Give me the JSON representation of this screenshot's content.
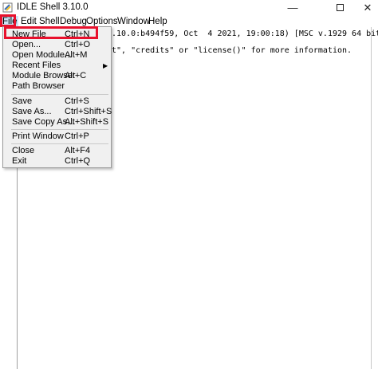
{
  "window": {
    "title": "IDLE Shell 3.10.0",
    "minimize_glyph": "—",
    "close_glyph": "✕"
  },
  "menubar": {
    "items": [
      "File",
      "Edit",
      "Shell",
      "Debug",
      "Options",
      "Window",
      "Help"
    ]
  },
  "shell": {
    "line1": "3.10.0:b494f59, Oct  4 2021, 19:00:18) [MSC v.1929 64 bit (",
    "line2": "ht\", \"credits\" or \"license()\" for more information."
  },
  "file_menu": {
    "items": [
      {
        "label": "New File",
        "shortcut": "Ctrl+N"
      },
      {
        "label": "Open...",
        "shortcut": "Ctrl+O"
      },
      {
        "label": "Open Module...",
        "shortcut": "Alt+M"
      },
      {
        "label": "Recent Files",
        "shortcut": "",
        "submenu_arrow": "▶"
      },
      {
        "label": "Module Browser",
        "shortcut": "Alt+C"
      },
      {
        "label": "Path Browser",
        "shortcut": ""
      },
      {
        "label": "Save",
        "shortcut": "Ctrl+S"
      },
      {
        "label": "Save As...",
        "shortcut": "Ctrl+Shift+S"
      },
      {
        "label": "Save Copy As...",
        "shortcut": "Alt+Shift+S"
      },
      {
        "label": "Print Window",
        "shortcut": "Ctrl+P"
      },
      {
        "label": "Close",
        "shortcut": "Alt+F4"
      },
      {
        "label": "Exit",
        "shortcut": "Ctrl+Q"
      }
    ]
  },
  "colors": {
    "highlight_border": "#e8112d",
    "menu_hover": "#cce4f7",
    "menu_background": "#f0f0f0"
  },
  "icons": [
    "python-idle-icon",
    "minimize-icon",
    "maximize-icon",
    "close-icon",
    "submenu-arrow-icon"
  ]
}
